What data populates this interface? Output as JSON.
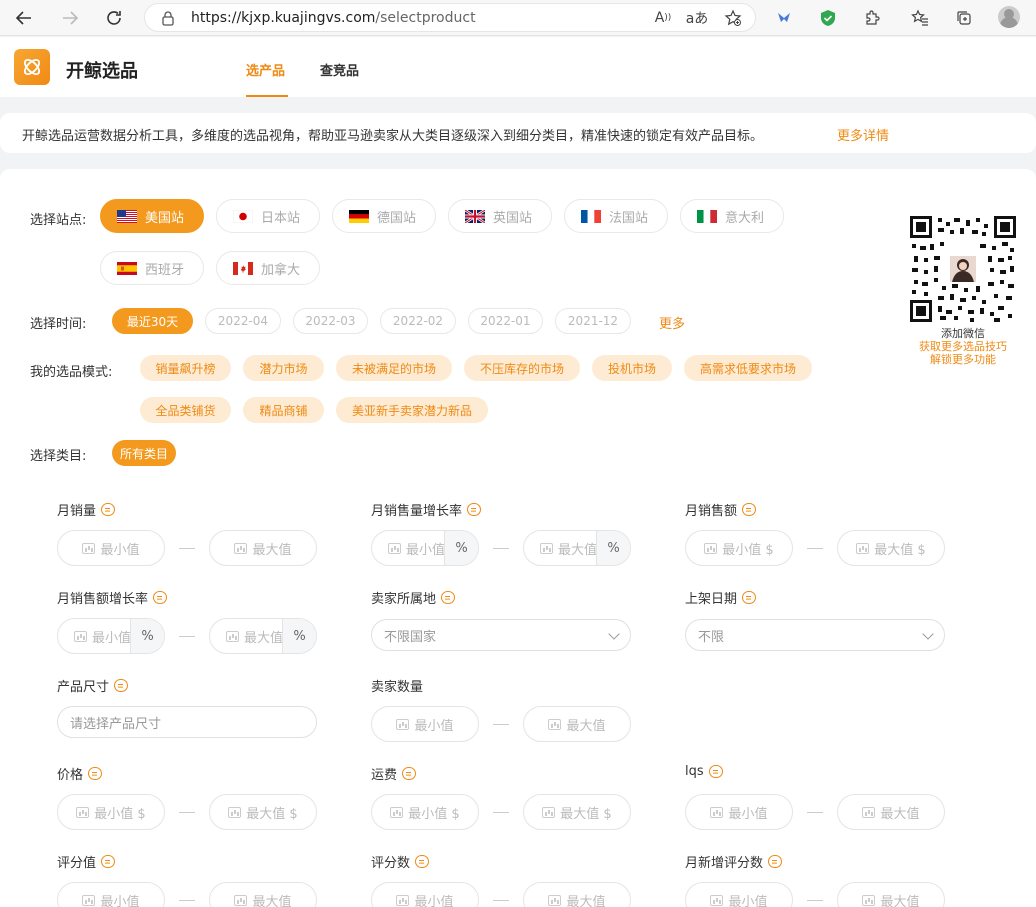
{
  "browser": {
    "url_host": "https://kjxp.kuajingvs.com",
    "url_path": "/selectproduct",
    "colors": {
      "accent": "#f08a14",
      "shield": "#2fa84f",
      "extension": "#4a7bd8"
    }
  },
  "header": {
    "brand": "开鲸选品",
    "tabs": [
      "选产品",
      "查竞品"
    ],
    "active_tab": "选产品"
  },
  "banner": {
    "text": "开鲸选品运营数据分析工具，多维度的选品视角，帮助亚马逊卖家从大类目逐级深入到细分类目，精准快速的锁定有效产品目标。",
    "link": "更多详情"
  },
  "sites": {
    "label": "选择站点:",
    "items": [
      {
        "name": "美国站",
        "flag": "us-flag",
        "active": true
      },
      {
        "name": "日本站",
        "flag": "jp-flag",
        "active": false
      },
      {
        "name": "德国站",
        "flag": "de-flag",
        "active": false
      },
      {
        "name": "英国站",
        "flag": "uk-flag",
        "active": false
      },
      {
        "name": "法国站",
        "flag": "fr-flag",
        "active": false
      },
      {
        "name": "意大利",
        "flag": "it-flag",
        "active": false
      },
      {
        "name": "西班牙",
        "flag": "es-flag",
        "active": false
      },
      {
        "name": "加拿大",
        "flag": "ca-flag",
        "active": false
      }
    ]
  },
  "time": {
    "label": "选择时间:",
    "items": [
      "最近30天",
      "2022-04",
      "2022-03",
      "2022-02",
      "2022-01",
      "2021-12"
    ],
    "active": "最近30天",
    "more": "更多"
  },
  "modes": {
    "label": "我的选品模式:",
    "items": [
      "销量飙升榜",
      "潜力市场",
      "未被满足的市场",
      "不压库存的市场",
      "投机市场",
      "高需求低要求市场",
      "全品类铺货",
      "精品商铺",
      "美亚新手卖家潜力新品"
    ]
  },
  "category": {
    "label": "选择类目:",
    "active": "所有类目"
  },
  "qr": {
    "line1": "添加微信",
    "line2": "获取更多选品技巧",
    "line3": "解锁更多功能"
  },
  "filters": {
    "min": "最小值",
    "max": "最大值",
    "min_dollar": "最小值 $",
    "max_dollar": "最大值 $",
    "percent": "%",
    "monthly_sales": "月销量",
    "monthly_sales_growth": "月销售量增长率",
    "monthly_revenue": "月销售额",
    "monthly_revenue_growth": "月销售额增长率",
    "seller_location": "卖家所属地",
    "seller_location_value": "不限国家",
    "listing_date": "上架日期",
    "listing_date_value": "不限",
    "product_size": "产品尺寸",
    "product_size_placeholder": "请选择产品尺寸",
    "seller_count": "卖家数量",
    "price": "价格",
    "shipping": "运费",
    "lqs": "lqs",
    "rating": "评分值",
    "review_count": "评分数",
    "monthly_new_reviews": "月新增评分数"
  }
}
